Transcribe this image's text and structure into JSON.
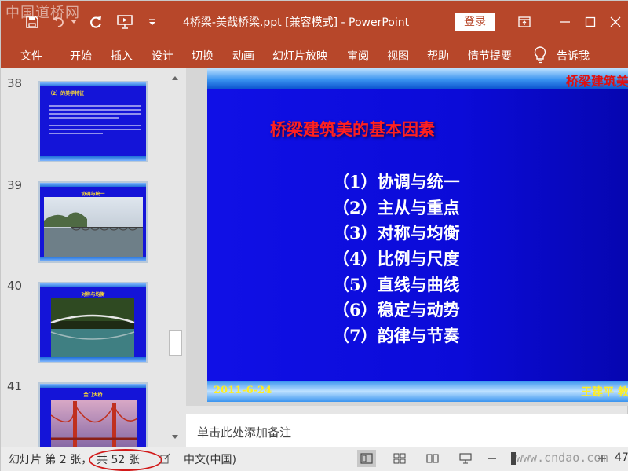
{
  "app": {
    "watermark": "中国道桥网",
    "doc_title": "4桥梁-美哉桥梁.ppt [兼容模式] - PowerPoint",
    "login_label": "登录"
  },
  "ribbon": {
    "tabs": [
      "文件",
      "开始",
      "插入",
      "设计",
      "切换",
      "动画",
      "幻灯片放映",
      "审阅",
      "视图",
      "帮助",
      "情节提要"
    ],
    "tell_me": "告诉我"
  },
  "thumbnails": [
    {
      "number": "38",
      "heading": "（2）的美学特征"
    },
    {
      "number": "39",
      "heading": "协调与统一"
    },
    {
      "number": "40",
      "heading": "对称与均衡"
    },
    {
      "number": "41",
      "heading": "金门大桥"
    }
  ],
  "slide": {
    "top_band_text": "桥梁建筑美",
    "title": "桥梁建筑美的基本因素",
    "items": [
      "（1）协调与统一",
      "（2）主从与重点",
      "（3）对称与均衡",
      "（4）比例与尺度",
      "（5）直线与曲线",
      "（6）稳定与动势",
      "（7）韵律与节奏"
    ],
    "date": "2011-6-24",
    "author": "王建平 教"
  },
  "notes": {
    "placeholder": "单击此处添加备注"
  },
  "status": {
    "slide_position": "幻灯片 第 2 张，",
    "slide_total": "共 52 张",
    "language": "中文(中国)",
    "zoom": "47",
    "site_watermark": "www.cndao.com"
  },
  "colors": {
    "accent": "#b7472a",
    "slide_bg": "#1010e6",
    "title_red": "#ff2020",
    "footer_yellow": "#ffee22",
    "highlight": "#d21a1a"
  }
}
